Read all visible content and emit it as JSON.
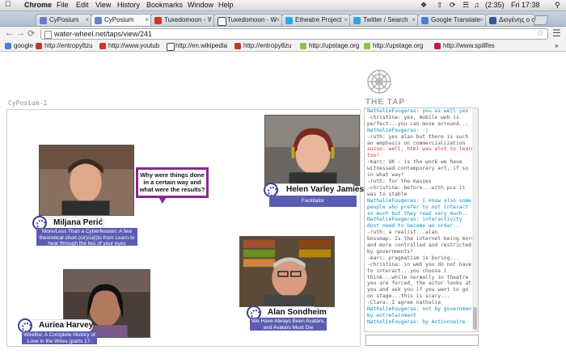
{
  "menubar": {
    "app": "Chrome",
    "items": [
      "File",
      "Edit",
      "View",
      "History",
      "Bookmarks",
      "Window",
      "Help"
    ],
    "battery": "(2:35)",
    "clock": "Fri 17:38"
  },
  "tabs": [
    {
      "label": "CyPosium",
      "color": "#6b7cc9"
    },
    {
      "label": "CyPosium ",
      "color": "#6b7cc9",
      "active": true
    },
    {
      "label": "Tuxedomoon - Y",
      "color": "#d93025"
    },
    {
      "label": "Tuxedomoon - W",
      "color": "#444"
    },
    {
      "label": "Etheatre Project",
      "color": "#2aa9e0"
    },
    {
      "label": "Twitter / Search",
      "color": "#2aa9e0"
    },
    {
      "label": "Google Translate",
      "color": "#4a7fd6"
    },
    {
      "label": "Διογένης ο σκύλο",
      "color": "#3b5998"
    }
  ],
  "toolbar": {
    "url": "water-wheel.net/taps/view/241"
  },
  "bookmarks": [
    {
      "label": "google",
      "color": "#4a7fd6"
    },
    {
      "label": "http://entropy8zu",
      "color": "#c0392b"
    },
    {
      "label": "http://www.youtub",
      "color": "#d93025"
    },
    {
      "label": "http://en.wikipedia",
      "color": "#444"
    },
    {
      "label": "http://entropy8zu",
      "color": "#c0392b"
    },
    {
      "label": "http://upstage.org",
      "color": "#8bc34a"
    },
    {
      "label": "http://upstage.org",
      "color": "#8bc34a"
    },
    {
      "label": "http://www.spillfes",
      "color": "#c2185b"
    }
  ],
  "logo_text": "THE TAP",
  "stage_label": "CyPosium-1",
  "participants": [
    {
      "name": "Miljana Perić",
      "caption": "More/Less Than a Cyberfession: A few theoretical short-(cir)cu(i)ts from Learn to hear through the lies of your eyes"
    },
    {
      "name": "Helen Varley Jamieson",
      "caption": "Facilitator"
    },
    {
      "name": "Alan Sondheim",
      "caption": "We Have Always Been Avatars, and Avatars Must Die"
    },
    {
      "name": "Auriea Harvey",
      "caption": "Wirefire: A Complete History of Love in the Wires (parts 17-24)"
    }
  ],
  "bubble_text": "Why were things done in a certain way and what were the results?",
  "chat": [
    {
      "text": "NathalieFougeras: you as well yes",
      "c": "b"
    },
    {
      "text": "-christina: yes, mobile web is perfect...you can move arround...",
      "c": "g"
    },
    {
      "text": "NathalieFougeras: :)",
      "c": "b"
    },
    {
      "text": "-ruth: yes alan but there is such an emphasis on commercialization",
      "c": "g"
    },
    {
      "text": "suzon: well, html was alot to learn too!",
      "c": "r"
    },
    {
      "text": "-marc: UK - is the work we have witnessed contemporary art, if so in what way?",
      "c": "g"
    },
    {
      "text": "-ruth: for the masses",
      "c": "g"
    },
    {
      "text": "-christina: before...with pcs it was to stable",
      "c": "g"
    },
    {
      "text": "NathalieFougeras: I know also some people who prefer to not interact so much but they read very much..",
      "c": "b"
    },
    {
      "text": "NathalieFougeras: interactivity dont need to become an order..",
      "c": "b"
    },
    {
      "text": "-ruth: a realist...alan",
      "c": "g"
    },
    {
      "text": "bossmap: Is the internet being more and more controlled and restricted by governments?",
      "c": "g"
    },
    {
      "text": "-marc: pragmatism is boring...",
      "c": "g"
    },
    {
      "text": "-christina: in web you do not have to interact...you choose i think...while normally in theatre you are forced, the actor looks at you and ask you if you want to go on stage...this is scary...",
      "c": "g"
    },
    {
      "text": "-Clara: I agree nathalie",
      "c": "g"
    },
    {
      "text": "NathalieFougeras: not by government by entretainment",
      "c": "b"
    },
    {
      "text": "NathalieFougeras: by Actionnaire",
      "c": "b"
    }
  ]
}
